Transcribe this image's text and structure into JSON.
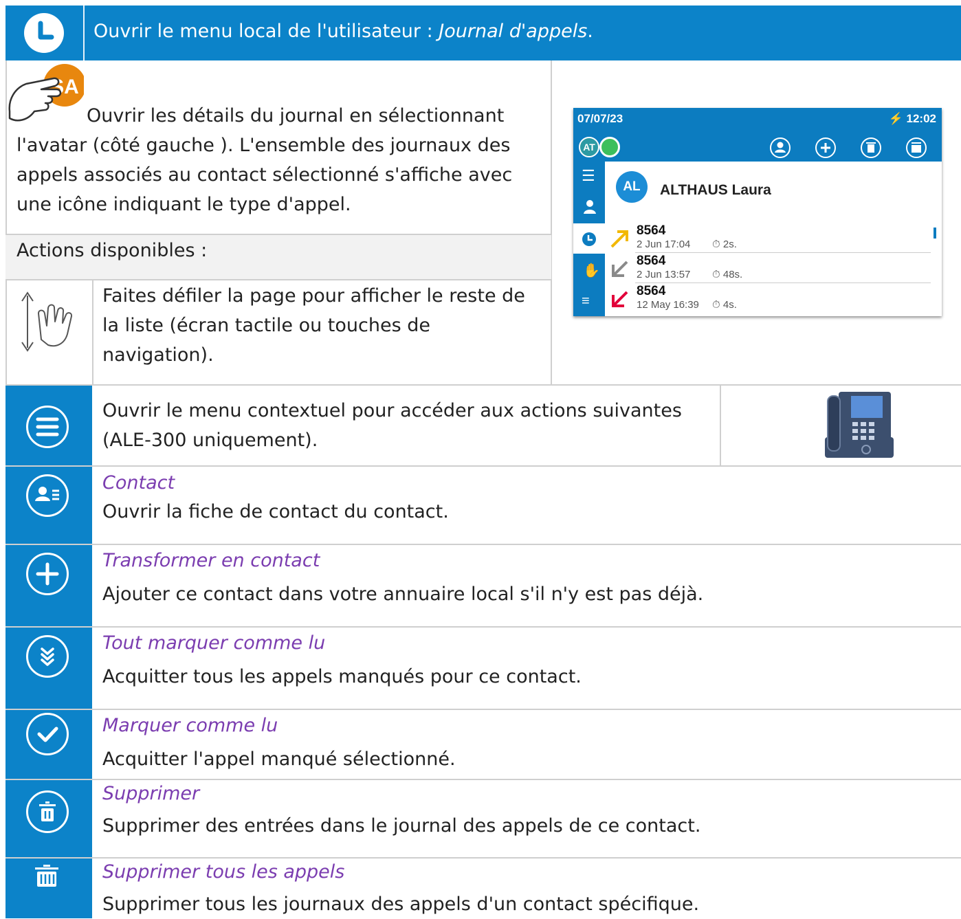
{
  "header": {
    "text": "Ouvrir le menu local de l'utilisateur : ",
    "italic": "Journal d'appels",
    "end": "."
  },
  "details": {
    "badge_initials": "SA",
    "line1": "Ouvrir les détails du journal en sélectionnant",
    "line2": "l'avatar (côté gauche ). L'ensemble des journaux des",
    "line3": "appels associés au contact sélectionné s'affiche avec",
    "line4": "une icône indiquant le type d'appel."
  },
  "actions_label": "Actions disponibles :",
  "scroll": {
    "line1": "Faites défiler la page pour afficher le reste de",
    "line2": "la liste (écran tactile ou touches de",
    "line3": "navigation)."
  },
  "phone_screen": {
    "date": "07/07/23",
    "time": "12:02",
    "status_initials": "AT",
    "contact_initials": "AL",
    "contact_name": "ALTHAUS Laura",
    "calls": [
      {
        "number": "8564",
        "date": "2 Jun 17:04",
        "duration": "2s.",
        "type": "outgoing",
        "color": "#F2B800"
      },
      {
        "number": "8564",
        "date": "2 Jun 13:57",
        "duration": "48s.",
        "type": "incoming",
        "color": "#8A8A8A"
      },
      {
        "number": "8564",
        "date": "12 May 16:39",
        "duration": "4s.",
        "type": "missed",
        "color": "#E2003A"
      }
    ]
  },
  "context_menu": {
    "line1": "Ouvrir le menu contextuel pour accéder aux actions suivantes",
    "line2": "(ALE-300 uniquement)."
  },
  "items": [
    {
      "title": "Contact",
      "desc": "Ouvrir la fiche de contact du contact.",
      "icon": "contact-card-icon"
    },
    {
      "title": "Transformer en contact",
      "desc": "Ajouter ce contact dans votre annuaire local s'il n'y est pas déjà.",
      "icon": "plus-icon"
    },
    {
      "title": "Tout marquer comme lu",
      "desc": "Acquitter tous les appels manqués pour ce contact.",
      "icon": "double-chevron-icon"
    },
    {
      "title": "Marquer comme lu",
      "desc": "Acquitter l'appel manqué sélectionné.",
      "icon": "check-icon"
    },
    {
      "title": "Supprimer",
      "desc": "Supprimer des entrées dans le journal des appels de ce contact.",
      "icon": "trash-icon"
    },
    {
      "title": "Supprimer tous les appels",
      "desc": "Supprimer tous les journaux des appels d'un contact spécifique.",
      "icon": "trash-all-icon"
    }
  ],
  "colors": {
    "accent": "#0C83C9",
    "italic_title": "#7B3DB0",
    "separator": "#CFCFCF"
  }
}
